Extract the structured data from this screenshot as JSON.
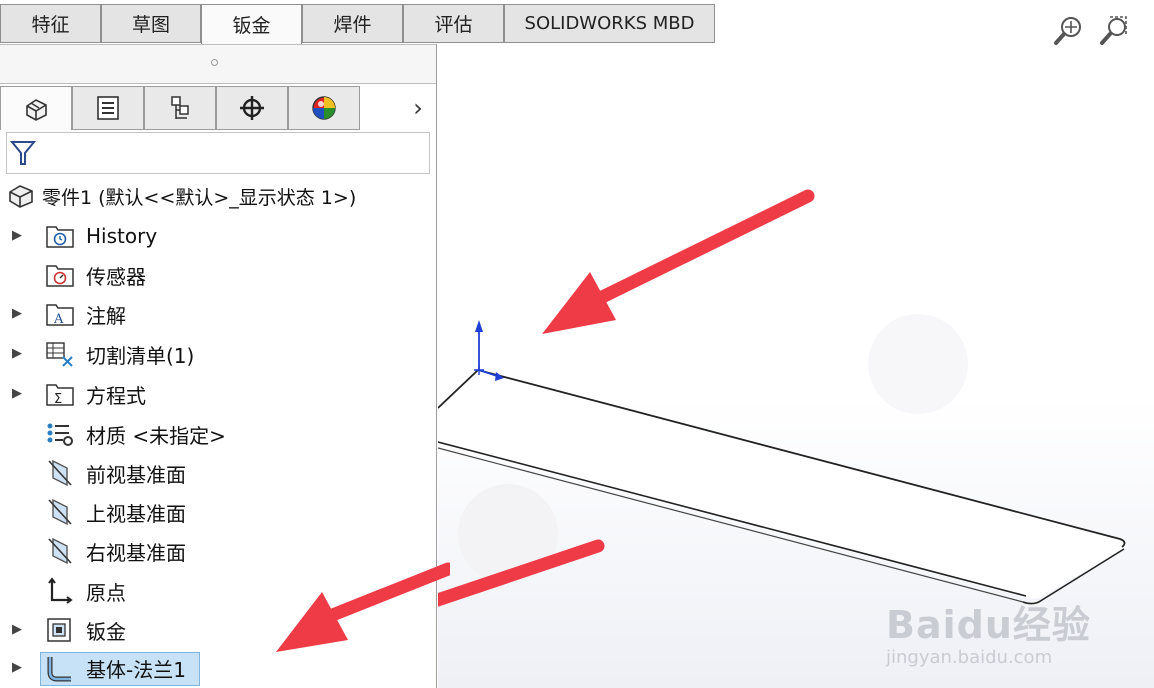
{
  "tabs": [
    {
      "label": "特征",
      "active": false
    },
    {
      "label": "草图",
      "active": false
    },
    {
      "label": "钣金",
      "active": true
    },
    {
      "label": "焊件",
      "active": false
    },
    {
      "label": "评估",
      "active": false
    },
    {
      "label": "SOLIDWORKS MBD",
      "active": false
    }
  ],
  "panel_tabs": [
    {
      "icon": "featuremanager-tree-icon",
      "active": true
    },
    {
      "icon": "propertymanager-icon",
      "active": false
    },
    {
      "icon": "configurationmanager-icon",
      "active": false
    },
    {
      "icon": "dimxpertmanager-icon",
      "active": false
    },
    {
      "icon": "displaymanager-icon",
      "active": false
    }
  ],
  "tree": {
    "root_label": "零件1  (默认<<默认>_显示状态 1>)",
    "items": [
      {
        "label": "History",
        "icon": "history-folder-icon",
        "expandable": true
      },
      {
        "label": "传感器",
        "icon": "sensors-folder-icon",
        "expandable": false
      },
      {
        "label": "注解",
        "icon": "annotations-folder-icon",
        "expandable": true
      },
      {
        "label": "切割清单(1)",
        "icon": "cut-list-icon",
        "expandable": true
      },
      {
        "label": "方程式",
        "icon": "equations-folder-icon",
        "expandable": true
      },
      {
        "label": "材质 <未指定>",
        "icon": "material-icon",
        "expandable": false
      },
      {
        "label": "前视基准面",
        "icon": "plane-icon",
        "expandable": false
      },
      {
        "label": "上视基准面",
        "icon": "plane-icon",
        "expandable": false
      },
      {
        "label": "右视基准面",
        "icon": "plane-icon",
        "expandable": false
      },
      {
        "label": "原点",
        "icon": "origin-icon",
        "expandable": false
      },
      {
        "label": "钣金",
        "icon": "sheet-metal-icon",
        "expandable": true
      },
      {
        "label": "基体-法兰1",
        "icon": "base-flange-icon",
        "expandable": true,
        "selected": true
      }
    ]
  },
  "watermark": {
    "logo": "Baidu经验",
    "url": "jingyan.baidu.com"
  },
  "colors": {
    "arrow": "#ee3b46",
    "axis": "#1e3fd6",
    "selection": "#c7e2f6"
  }
}
